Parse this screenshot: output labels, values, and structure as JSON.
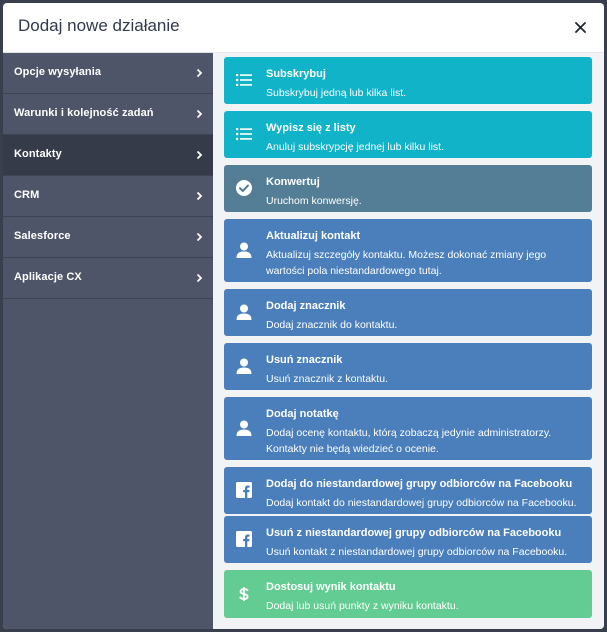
{
  "modal": {
    "title": "Dodaj nowe działanie"
  },
  "sidebar": {
    "items": [
      {
        "label": "Opcje wysyłania"
      },
      {
        "label": "Warunki i kolejność zadań"
      },
      {
        "label": "Kontakty",
        "active": true
      },
      {
        "label": "CRM"
      },
      {
        "label": "Salesforce"
      },
      {
        "label": "Aplikacje CX"
      }
    ]
  },
  "actions": [
    {
      "title": "Subskrybuj",
      "desc": "Subskrybuj jedną lub kilka list.",
      "icon": "list-icon",
      "color": "#11b3c9"
    },
    {
      "title": "Wypisz się z listy",
      "desc": "Anuluj subskrypcję jednej lub kilku list.",
      "icon": "list-icon",
      "color": "#11b3c9"
    },
    {
      "title": "Konwertuj",
      "desc": "Uruchom konwersję.",
      "icon": "check-circle-icon",
      "color": "#547e96"
    },
    {
      "title": "Aktualizuj kontakt",
      "desc": "Aktualizuj szczegóły kontaktu. Możesz dokonać zmiany jego wartości pola niestandardowego tutaj.",
      "icon": "user-icon",
      "color": "#4a7fbb"
    },
    {
      "title": "Dodaj znacznik",
      "desc": "Dodaj znacznik do kontaktu.",
      "icon": "user-icon",
      "color": "#4a7fbb"
    },
    {
      "title": "Usuń znacznik",
      "desc": "Usuń znacznik z kontaktu.",
      "icon": "user-icon",
      "color": "#4a7fbb"
    },
    {
      "title": "Dodaj notatkę",
      "desc": "Dodaj ocenę kontaktu, którą zobaczą jedynie administratorzy. Kontakty nie będą wiedzieć o ocenie.",
      "icon": "user-icon",
      "color": "#4a7fbb"
    },
    {
      "title": "Dodaj do niestandardowej grupy odbiorców na Facebooku",
      "desc": "Dodaj kontakt do niestandardowej grupy odbiorców na Facebooku.",
      "icon": "facebook-icon",
      "color": "#4a7fbb"
    },
    {
      "title": "Usuń z niestandardowej grupy odbiorców na Facebooku",
      "desc": "Usuń kontakt z niestandardowej grupy odbiorców na Facebooku.",
      "icon": "facebook-icon",
      "color": "#4a7fbb"
    },
    {
      "title": "Dostosuj wynik kontaktu",
      "desc": "Dodaj lub usuń punkty z wyniku kontaktu.",
      "icon": "dollar-icon",
      "color": "#63cc92"
    }
  ]
}
